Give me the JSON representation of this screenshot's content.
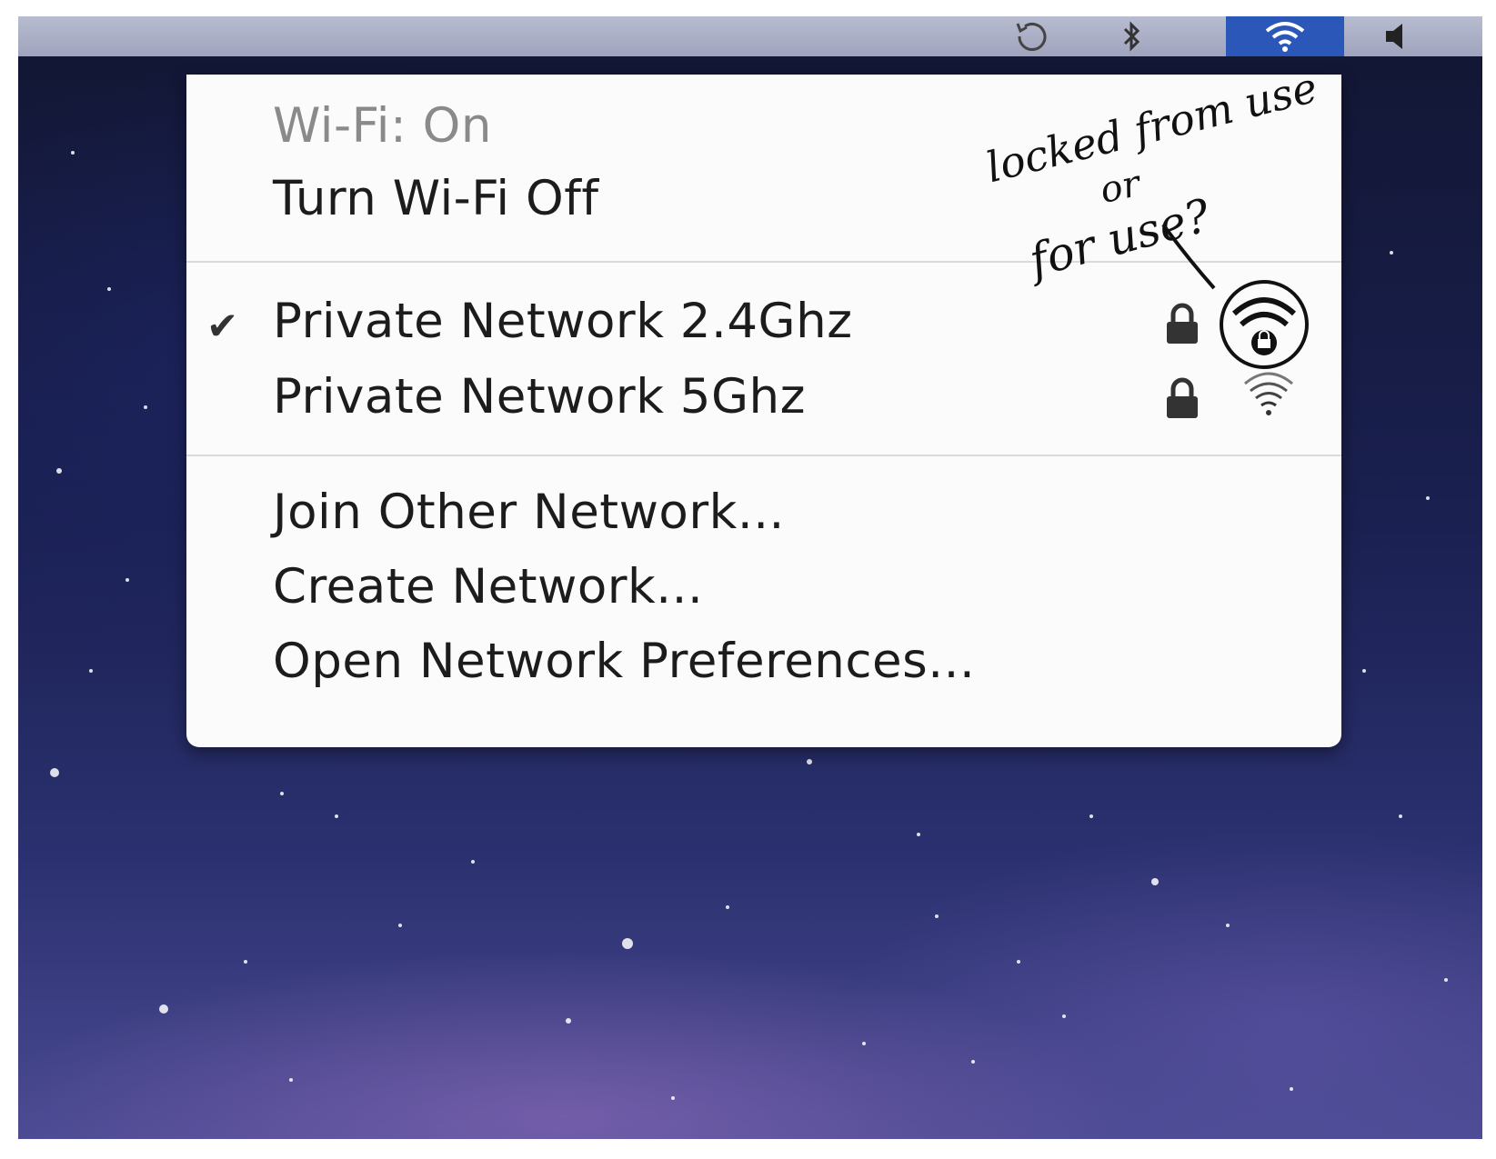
{
  "menubar": {
    "icons": [
      "time-machine-icon",
      "bluetooth-icon",
      "wifi-icon",
      "volume-icon"
    ],
    "highlight_color": "#2b58b8"
  },
  "wifi_menu": {
    "status": "Wi-Fi: On",
    "toggle": "Turn Wi-Fi Off",
    "networks": [
      {
        "name": "Private Network 2.4Ghz",
        "selected": true,
        "secured": true
      },
      {
        "name": "Private Network 5Ghz",
        "selected": false,
        "secured": true
      }
    ],
    "actions": {
      "join_other": "Join Other Network...",
      "create": "Create Network...",
      "open_prefs": "Open Network Preferences..."
    }
  },
  "annotation": {
    "line1": "locked from use",
    "line2": "or",
    "line3": "for use?"
  }
}
